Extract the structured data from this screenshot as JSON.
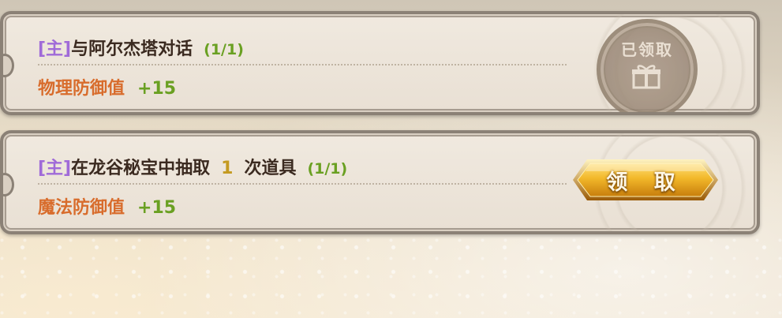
{
  "quests": [
    {
      "tag": "[主]",
      "title": "与阿尔杰塔对话",
      "progress": "(1/1)",
      "reward_name": "物理防御值",
      "reward_value": "+15",
      "status": "已领取"
    },
    {
      "tag": "[主]",
      "title_pre": "在龙谷秘宝中抽取",
      "title_num": "1",
      "title_post": "次道具",
      "progress": "(1/1)",
      "reward_name": "魔法防御值",
      "reward_value": "+15",
      "button_label": "领 取"
    }
  ],
  "stamp_icon": "gift-icon",
  "colors": {
    "tag": "#a06ad8",
    "progress": "#6aa022",
    "reward_name": "#d86c2c",
    "button_gold": "#e6a91c"
  }
}
